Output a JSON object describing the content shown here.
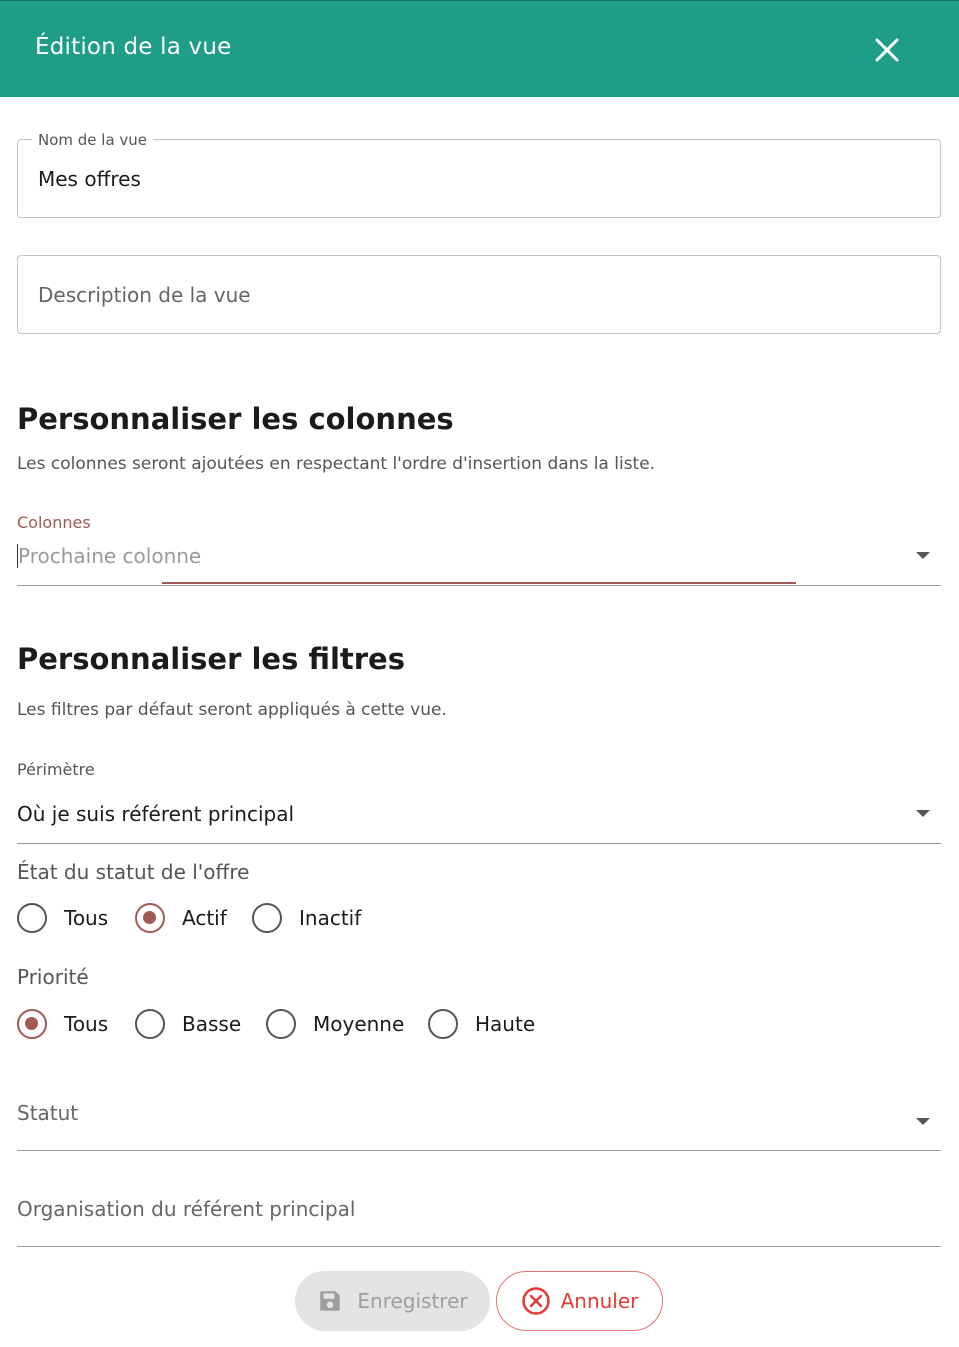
{
  "dialog": {
    "title": "Édition de la vue"
  },
  "name_field": {
    "label": "Nom de la vue",
    "value": "Mes offres"
  },
  "description_field": {
    "placeholder": "Description de la vue"
  },
  "columns_section": {
    "title": "Personnaliser les colonnes",
    "description": "Les colonnes seront ajoutées en respectant l'ordre d'insertion dans la liste.",
    "field_label": "Colonnes",
    "field_placeholder": "Prochaine colonne"
  },
  "filters_section": {
    "title": "Personnaliser les filtres",
    "description": "Les filtres par défaut seront appliqués à cette vue.",
    "perimeter": {
      "label": "Périmètre",
      "value": "Où je suis référent principal"
    },
    "status_state": {
      "label": "État du statut de l'offre",
      "options": [
        "Tous",
        "Actif",
        "Inactif"
      ],
      "selected": "Actif"
    },
    "priority": {
      "label": "Priorité",
      "options": [
        "Tous",
        "Basse",
        "Moyenne",
        "Haute"
      ],
      "selected": "Tous"
    },
    "status": {
      "placeholder": "Statut"
    },
    "organisation": {
      "placeholder": "Organisation du référent principal"
    }
  },
  "actions": {
    "save_label": "Enregistrer",
    "cancel_label": "Annuler"
  },
  "colors": {
    "header": "#1e9e86",
    "accent": "#a15a55",
    "cancel": "#e53935",
    "disabled": "#9e9e9e"
  }
}
